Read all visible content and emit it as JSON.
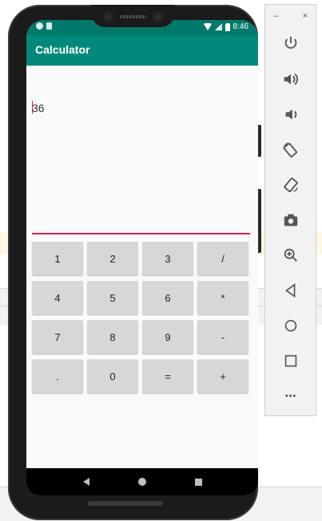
{
  "emulator": {
    "status_bar": {
      "time": "8:46"
    },
    "app": {
      "title": "Calculator",
      "display": "36"
    },
    "keypad": [
      {
        "name": "key-1",
        "label": "1"
      },
      {
        "name": "key-2",
        "label": "2"
      },
      {
        "name": "key-3",
        "label": "3"
      },
      {
        "name": "key-divide",
        "label": "/"
      },
      {
        "name": "key-4",
        "label": "4"
      },
      {
        "name": "key-5",
        "label": "5"
      },
      {
        "name": "key-6",
        "label": "6"
      },
      {
        "name": "key-multiply",
        "label": "*"
      },
      {
        "name": "key-7",
        "label": "7"
      },
      {
        "name": "key-8",
        "label": "8"
      },
      {
        "name": "key-9",
        "label": "9"
      },
      {
        "name": "key-subtract",
        "label": "-"
      },
      {
        "name": "key-decimal",
        "label": "."
      },
      {
        "name": "key-0",
        "label": "0"
      },
      {
        "name": "key-equals",
        "label": "="
      },
      {
        "name": "key-add",
        "label": "+"
      }
    ],
    "colors": {
      "app_bar": "#00897b",
      "status_bar": "#00796b",
      "accent": "#d81b60",
      "key_background": "#d6d7d7"
    }
  },
  "toolbar": {
    "window_controls": {
      "minimize": "–",
      "close": "×"
    },
    "buttons": [
      "power-icon",
      "volume-up-icon",
      "volume-down-icon",
      "rotate-left-icon",
      "rotate-right-icon",
      "camera-icon",
      "zoom-icon",
      "back-icon",
      "home-icon",
      "overview-icon",
      "more-icon"
    ],
    "more_label": "•••"
  }
}
